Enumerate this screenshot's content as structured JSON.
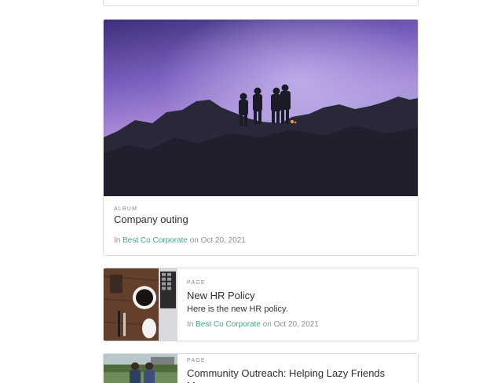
{
  "album_card": {
    "type_label": "ALBUM",
    "title": "Company outing",
    "meta_prefix": "In",
    "meta_link": "Best Co Corporate",
    "meta_suffix": "on Oct 20, 2021"
  },
  "page_cards": [
    {
      "type_label": "PAGE",
      "title": "New HR Policy",
      "description": "Here is the new HR policy.",
      "meta_prefix": "In",
      "meta_link": "Best Co Corporate",
      "meta_suffix": "on Oct 20, 2021"
    },
    {
      "type_label": "PAGE",
      "title": "Community Outreach: Helping Lazy Friends Move"
    }
  ],
  "colors": {
    "link": "#3ea88a",
    "border": "#dcdcdc"
  }
}
